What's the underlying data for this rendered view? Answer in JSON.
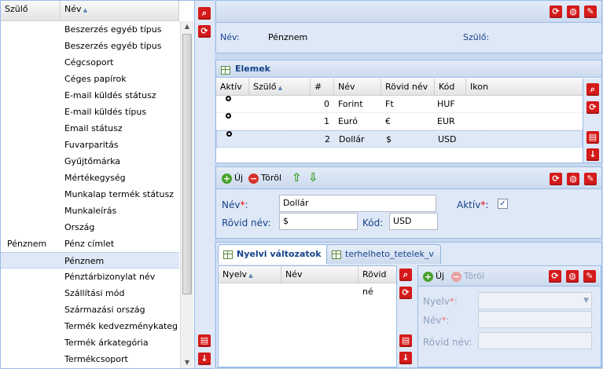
{
  "left": {
    "columns": {
      "parent": "Szülő",
      "name": "Név"
    },
    "rows": [
      {
        "parent": "",
        "name": "Beszerzés egyéb típus"
      },
      {
        "parent": "",
        "name": "Beszerzés egyéb típus"
      },
      {
        "parent": "",
        "name": "Cégcsoport"
      },
      {
        "parent": "",
        "name": "Céges papírok"
      },
      {
        "parent": "",
        "name": "E-mail küldés státusz"
      },
      {
        "parent": "",
        "name": "E-mail küldés típus"
      },
      {
        "parent": "",
        "name": "Email státusz"
      },
      {
        "parent": "",
        "name": "Fuvarparitás"
      },
      {
        "parent": "",
        "name": "Gyűjtőmárka"
      },
      {
        "parent": "",
        "name": "Mértékegység"
      },
      {
        "parent": "",
        "name": "Munkalap termék státusz"
      },
      {
        "parent": "",
        "name": "Munkaleírás"
      },
      {
        "parent": "",
        "name": "Ország"
      },
      {
        "parent": "Pénznem",
        "name": "Pénz címlet"
      },
      {
        "parent": "",
        "name": "Pénznem"
      },
      {
        "parent": "",
        "name": "Pénztárbizonylat név"
      },
      {
        "parent": "",
        "name": "Szállítási mód"
      },
      {
        "parent": "",
        "name": "Származási ország"
      },
      {
        "parent": "",
        "name": "Termék kedvezménykateg..."
      },
      {
        "parent": "",
        "name": "Termék árkategória"
      },
      {
        "parent": "",
        "name": "Termékcsoport"
      }
    ]
  },
  "header": {
    "name_label": "Név:",
    "name_value": "Pénznem",
    "parent_label": "Szülő:"
  },
  "elemek": {
    "title": "Elemek",
    "columns": {
      "active": "Aktív",
      "parent": "Szülő",
      "num": "#",
      "name": "Név",
      "short": "Rövid név",
      "code": "Kód",
      "icon": "Ikon"
    },
    "rows": [
      {
        "num": "0",
        "name": "Forint",
        "short": "Ft",
        "code": "HUF"
      },
      {
        "num": "1",
        "name": "Euró",
        "short": "€",
        "code": "EUR"
      },
      {
        "num": "2",
        "name": "Dollár",
        "short": "$",
        "code": "USD"
      }
    ]
  },
  "form": {
    "new_label": "Új",
    "delete_label": "Töröl",
    "name_label": "Név",
    "name_value": "Dollár",
    "active_label": "Aktív",
    "short_label": "Rövid név:",
    "short_value": "$",
    "code_label": "Kód:",
    "code_value": "USD"
  },
  "tabs": {
    "tab1": "Nyelvi változatok",
    "tab2": "terhelheto_tetelek_v",
    "grid_columns": {
      "lang": "Nyelv",
      "name": "Név",
      "short": "Rövid né"
    },
    "new_label": "Új",
    "delete_label": "Töröl",
    "lang_label": "Nyelv",
    "name_label": "Név",
    "short_label": "Rövid név:"
  },
  "colors": {
    "accent": "#15428b",
    "panel": "#dfe8f6",
    "border": "#99bbe8",
    "button": "#d51a1a"
  }
}
